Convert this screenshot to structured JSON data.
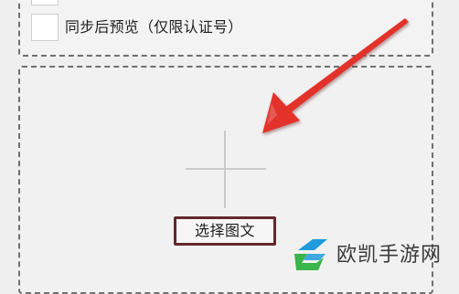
{
  "sync_preview": {
    "label": "同步后预览（仅限认证号）",
    "checked": false
  },
  "upload": {
    "plus_icon": "plus-icon",
    "select_button_label": "选择图文",
    "highlight_color": "#61282d"
  },
  "annotation": {
    "arrow_icon": "red-arrow-icon",
    "arrow_color": "#e0332c"
  },
  "watermark": {
    "brand": "欧凯手游网",
    "logo_colors": [
      "#1f9bdc",
      "#3ab54a"
    ]
  }
}
